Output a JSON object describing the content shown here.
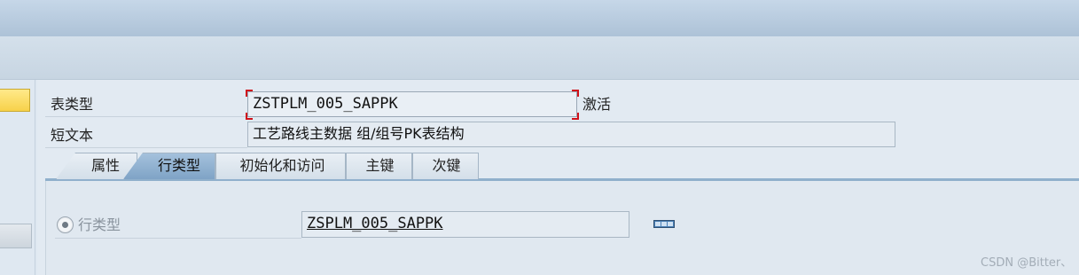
{
  "header": {
    "table_category_label": "表类型",
    "table_category_value": "ZSTPLM_005_SAPPK",
    "status": "激活",
    "short_text_label": "短文本",
    "short_text_value": "工艺路线主数据 组/组号PK表结构"
  },
  "tabs": [
    {
      "label": "属性",
      "active": false
    },
    {
      "label": "行类型",
      "active": true
    },
    {
      "label": "初始化和访问",
      "active": false
    },
    {
      "label": "主键",
      "active": false
    },
    {
      "label": "次键",
      "active": false
    }
  ],
  "line_type": {
    "radio_label": "行类型",
    "value": "ZSPLM_005_SAPPK",
    "icon": "matchcode-icon"
  },
  "watermark": "CSDN @Bitter、",
  "colors": {
    "active_tab": "#8eaed0",
    "focus_corner": "#d0131b",
    "highlight_button": "#f7d24a"
  }
}
